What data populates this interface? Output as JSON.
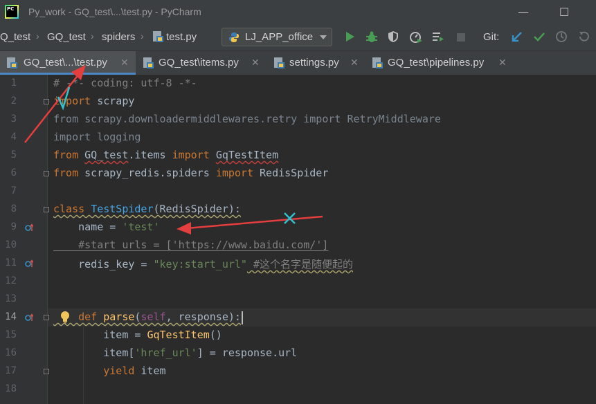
{
  "window": {
    "title": "Py_work - GQ_test\\...\\test.py - PyCharm",
    "logo_text": "PC",
    "minimize": "—",
    "maximize": "☐"
  },
  "breadcrumbs": [
    "Q_test",
    "GQ_test",
    "spiders",
    "test.py"
  ],
  "toolbar": {
    "run_config": "LJ_APP_office",
    "git_label": "Git:"
  },
  "tabs": [
    {
      "label": "GQ_test\\...\\test.py",
      "active": true
    },
    {
      "label": "GQ_test\\items.py",
      "active": false
    },
    {
      "label": "settings.py",
      "active": false
    },
    {
      "label": "GQ_test\\pipelines.py",
      "active": false
    }
  ],
  "editor": {
    "line_numbers": [
      "1",
      "2",
      "3",
      "4",
      "5",
      "6",
      "7",
      "8",
      "9",
      "10",
      "11",
      "12",
      "13",
      "14",
      "15",
      "16",
      "17",
      "18"
    ],
    "code": {
      "l1": "# -*- coding: utf-8 -*-",
      "l2_kw": "import",
      "l2_rest": " scrapy",
      "l3_kw1": "from",
      "l3_mod": " scrapy.downloadermiddlewares.retry ",
      "l3_kw2": "import",
      "l3_name": " RetryMiddleware",
      "l4_kw": "import",
      "l4_rest": " logging",
      "l5_kw1": "from",
      "l5_mod": "GQ_test",
      "l5_mod2": ".items ",
      "l5_kw2": "import",
      "l5_name": "GqTestItem",
      "l6_kw1": "from",
      "l6_mod": " scrapy_redis.spiders ",
      "l6_kw2": "import",
      "l6_name": " RedisSpider",
      "l8_kw": "class",
      "l8_name": "TestSpider",
      "l8_paren": "(RedisSpider):",
      "l9_var": "    name = ",
      "l9_str": "'test'",
      "l10_cm_a": "    #start_urls = [",
      "l10_cm_b": "'https://www.baidu.com/'",
      "l10_cm_c": "]",
      "l11_var": "    redis_key = ",
      "l11_str": "\"key:start_url\"",
      "l11_cm": " #这个名字是随便起的",
      "l14_kw": "    def",
      "l14_fn": "parse",
      "l14_p1": "(",
      "l14_self": "self",
      "l14_rest": ", response):",
      "l15_a": "        item = ",
      "l15_cls": "GqTestItem",
      "l15_b": "()",
      "l16_a": "        item[",
      "l16_str": "'href_url'",
      "l16_b": "] = response.url",
      "l17_kw": "        yield",
      "l17_rest": " item"
    }
  },
  "colors": {
    "accent_blue": "#4a88c7",
    "run_green": "#499c54",
    "annotation_red": "#e53e3e",
    "annotation_cyan": "#2ec3cf"
  }
}
